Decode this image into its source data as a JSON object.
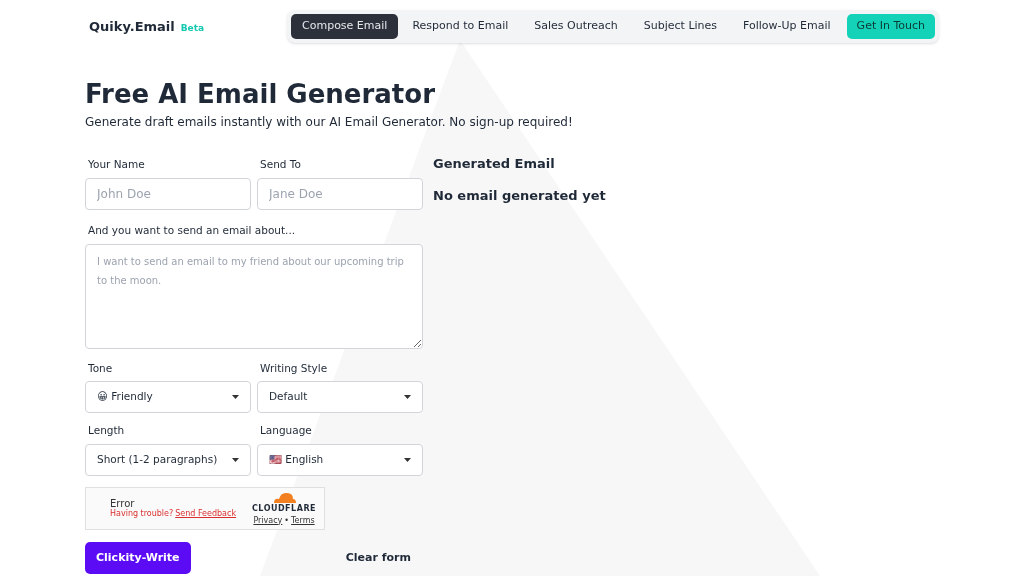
{
  "brand": {
    "name": "Quiky.Email",
    "badge": "Beta"
  },
  "nav": [
    {
      "label": "Compose Email",
      "selected": true
    },
    {
      "label": "Respond to Email",
      "selected": false
    },
    {
      "label": "Sales Outreach",
      "selected": false
    },
    {
      "label": "Subject Lines",
      "selected": false
    },
    {
      "label": "Follow-Up Email",
      "selected": false
    }
  ],
  "cta": "Get In Touch",
  "title": "Free AI Email Generator",
  "subtitle": "Generate draft emails instantly with our AI Email Generator. No sign-up required!",
  "fields": {
    "your_name": {
      "label": "Your Name",
      "placeholder": "John Doe"
    },
    "send_to": {
      "label": "Send To",
      "placeholder": "Jane Doe"
    },
    "about": {
      "label": "And you want to send an email about...",
      "placeholder": "I want to send an email to my friend about our upcoming trip to the moon."
    }
  },
  "selects": [
    {
      "label": "Tone",
      "value": "😀 Friendly"
    },
    {
      "label": "Writing Style",
      "value": "Default"
    },
    {
      "label": "Length",
      "value": "Short (1-2 paragraphs)"
    },
    {
      "label": "Language",
      "value": "🇺🇸 English"
    }
  ],
  "captcha": {
    "status": "Error",
    "trouble": "Having trouble?",
    "feedback": "Send Feedback",
    "logo": "CLOUDFLARE",
    "privacy": "Privacy",
    "separator": "•",
    "terms": "Terms"
  },
  "buttons": {
    "submit": "Clickity-Write",
    "clear": "Clear form"
  },
  "output": {
    "heading": "Generated Email",
    "empty": "No email generated yet"
  }
}
